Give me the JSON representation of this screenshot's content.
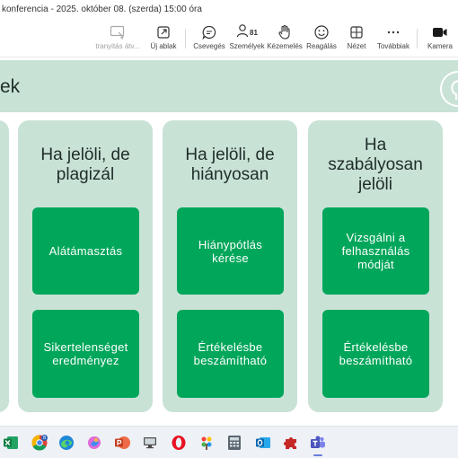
{
  "window": {
    "title": "konferencia - 2025. október 08. (szerda) 15:00 óra"
  },
  "toolbar": {
    "items": [
      {
        "label": "tranyitás átv...",
        "icon": "screen-share-control-icon"
      },
      {
        "label": "Új ablak",
        "icon": "new-window-icon"
      },
      {
        "label": "Csevegés",
        "icon": "chat-icon"
      },
      {
        "label": "Személyek",
        "icon": "people-icon",
        "count": "81"
      },
      {
        "label": "Kézemelés",
        "icon": "raise-hand-icon"
      },
      {
        "label": "Reagálás",
        "icon": "react-smiley-icon"
      },
      {
        "label": "Nézet",
        "icon": "view-grid-icon"
      },
      {
        "label": "Továbbiak",
        "icon": "more-icon"
      },
      {
        "label": "Kamera",
        "icon": "camera-icon"
      }
    ]
  },
  "slide": {
    "title_fragment": "ek",
    "columns": [
      {
        "title": [
          "Ha jelöli, de",
          "plagizál"
        ],
        "tiles": [
          [
            "Alátámasztás"
          ],
          [
            "Sikertelenséget",
            "eredményez"
          ]
        ]
      },
      {
        "title": [
          "Ha jelöli, de",
          "hiányosan"
        ],
        "tiles": [
          [
            "Hiánypótlás",
            "kérése"
          ],
          [
            "Értékelésbe",
            "beszámítható"
          ]
        ]
      },
      {
        "title": [
          "Ha",
          "szabályosan",
          "jelöli"
        ],
        "tiles": [
          [
            "Vizsgálni a",
            "felhasználás",
            "módját"
          ],
          [
            "Értékelésbe",
            "beszámítható"
          ]
        ]
      }
    ],
    "colors": {
      "header_bg": "#c9e2d6",
      "column_bg": "#c9e2d6",
      "tile_bg": "#00a65a",
      "tile_text": "#ffffff"
    }
  },
  "taskbar": {
    "apps": [
      "excel-icon",
      "chrome-icon",
      "edge-icon",
      "copilot-icon",
      "powerpoint-icon",
      "remote-desktop-icon",
      "opera-icon",
      "paint-icon",
      "calculator-icon",
      "outlook-icon",
      "puzzle-app-icon",
      "teams-icon"
    ],
    "chrome_badge": "8"
  }
}
